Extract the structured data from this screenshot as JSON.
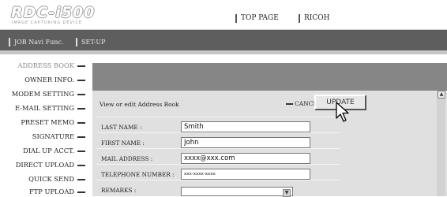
{
  "header": {
    "logo_text": "RDC-i500",
    "logo_subtitle": "IMAGE CAPTURING DEVICE",
    "top_page_link": "TOP PAGE",
    "ricoh_link": "RICOH"
  },
  "navbar": {
    "job_navi_label": "JOB Navi Func.",
    "setup_label": "SET-UP"
  },
  "sidebar": {
    "items": [
      {
        "label": "ADDRESS BOOK"
      },
      {
        "label": "OWNER INFO."
      },
      {
        "label": "MODEM SETTING"
      },
      {
        "label": "E-MAIL SETTING"
      },
      {
        "label": "PRESET MEMO"
      },
      {
        "label": "SIGNATURE"
      },
      {
        "label": "DIAL UP ACCT."
      },
      {
        "label": "DIRECT UPLOAD"
      },
      {
        "label": "QUICK SEND"
      },
      {
        "label": "FTP UPLOAD"
      }
    ]
  },
  "main": {
    "instruction": "View or edit Address Book",
    "cancel_label": "CANCEL",
    "update_label": "UPDATE",
    "fields": {
      "last_name": {
        "label": "LAST NAME :",
        "value": "Smith"
      },
      "first_name": {
        "label": "FIRST NAME :",
        "value": "John"
      },
      "mail_address": {
        "label": "MAIL ADDRESS :",
        "value": "xxxx@xxx.com"
      },
      "telephone": {
        "label": "TELEPHONE NUMBER :",
        "value": "xxx-xxxx-xxxx"
      },
      "remarks": {
        "label": "REMARKS :",
        "value": ""
      }
    }
  },
  "icons": {
    "scroll_up": "▲",
    "dropdown": "▼"
  }
}
